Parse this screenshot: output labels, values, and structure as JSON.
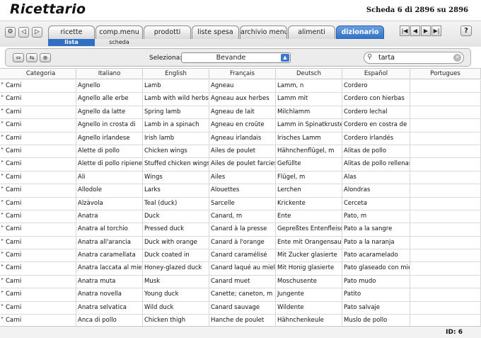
{
  "app": {
    "title": "Ricettario",
    "record_info": "Scheda 6 di 2896 su 2896"
  },
  "toolbar": {
    "tabs": [
      "ricette",
      "comp.menu",
      "prodotti",
      "liste spesa",
      "archivio menu",
      "alimenti",
      "dizionario"
    ],
    "active_tab": "dizionario",
    "subtabs": [
      "lista",
      "scheda"
    ],
    "active_subtab": "lista",
    "left_icons": [
      "gear-icon",
      "back-icon",
      "forward-icon"
    ],
    "nav_icons": [
      "first-record-icon",
      "previous-record-icon",
      "next-record-icon",
      "last-record-icon"
    ],
    "help_label": "?"
  },
  "filter": {
    "select_label": "Seleziona:",
    "select_value": "Bevande",
    "search_value": "tarta"
  },
  "table": {
    "columns": [
      "Categoria",
      "Italiano",
      "English",
      "Français",
      "Deutsch",
      "Español",
      "Portugues"
    ],
    "rows": [
      [
        "Carni",
        "Agnello",
        "Lamb",
        "Agneau",
        "Lamm, n",
        "Cordero",
        ""
      ],
      [
        "Carni",
        "Agnello alle erbe",
        "Lamb with wild herbs",
        "Agneau aux herbes",
        "Lamm mit",
        "Cordero con hierbas",
        ""
      ],
      [
        "Carni",
        "Agnello da latte",
        "Spring lamb",
        "Agneau de lait",
        "Milchlamm",
        "Cordero lechal",
        ""
      ],
      [
        "Carni",
        "Agnello in crosta di",
        "Lamb in a spinach",
        "Agneau en croûte",
        "Lamm in Spinatkruste",
        "Cordero en costra de",
        ""
      ],
      [
        "Carni",
        "Agnello irlandese",
        "Irish lamb",
        "Agneau irlandais",
        "Irisches Lamm",
        "Cordero irlandés",
        ""
      ],
      [
        "Carni",
        "Alette di pollo",
        "Chicken wings",
        "Ailes de poulet",
        "Hähnchenflügel, m",
        "Alitas de pollo",
        ""
      ],
      [
        "Carni",
        "Alette di pollo ripiene",
        "Stuffed chicken wings",
        "Ailes de poulet farcies",
        "Gefüllte",
        "Alitas de pollo rellenas",
        ""
      ],
      [
        "Carni",
        "Ali",
        "Wings",
        "Ailes",
        "Flügel, m",
        "Alas",
        ""
      ],
      [
        "Carni",
        "Allodole",
        "Larks",
        "Alouettes",
        "Lerchen",
        "Alondras",
        ""
      ],
      [
        "Carni",
        "Alzàvola",
        "Teal (duck)",
        "Sarcelle",
        "Krickente",
        "Cerceta",
        ""
      ],
      [
        "Carni",
        "Anatra",
        "Duck",
        "Canard, m",
        "Ente",
        "Pato, m",
        ""
      ],
      [
        "Carni",
        "Anatra al torchio",
        "Pressed duck",
        "Canard à la presse",
        "Gepreßtes Entenfleisch",
        "Pato a la sangre",
        ""
      ],
      [
        "Carni",
        "Anatra all'arancia",
        "Duck with orange",
        "Canard à l'orange",
        "Ente mit Orangensauce",
        "Pato a la naranja",
        ""
      ],
      [
        "Carni",
        "Anatra caramellata",
        "Duck coated in",
        "Canard caramélisé",
        "Mit Zucker glasierte",
        "Pato acaramelado",
        ""
      ],
      [
        "Carni",
        "Anatra laccata al miele",
        "Honey-glazed duck",
        "Canard laqué au miel",
        "Mit Honig glasierte",
        "Pato glaseado con miel",
        ""
      ],
      [
        "Carni",
        "Anatra muta",
        "Musk",
        "Canard muet",
        "Moschusente",
        "Pato mudo",
        ""
      ],
      [
        "Carni",
        "Anatra novella",
        "Young duck",
        "Canette; caneton, m",
        "Jungente",
        "Patito",
        ""
      ],
      [
        "Carni",
        "Anatra selvatica",
        "Wild duck",
        "Canard sauvage",
        "Wildente",
        "Pato salvaje",
        ""
      ],
      [
        "Carni",
        "Anca di pollo",
        "Chicken thigh",
        "Hanche de poulet",
        "Hähnchenkeule",
        "Muslo de pollo",
        ""
      ]
    ]
  },
  "footer": {
    "record_id": "ID: 6"
  }
}
